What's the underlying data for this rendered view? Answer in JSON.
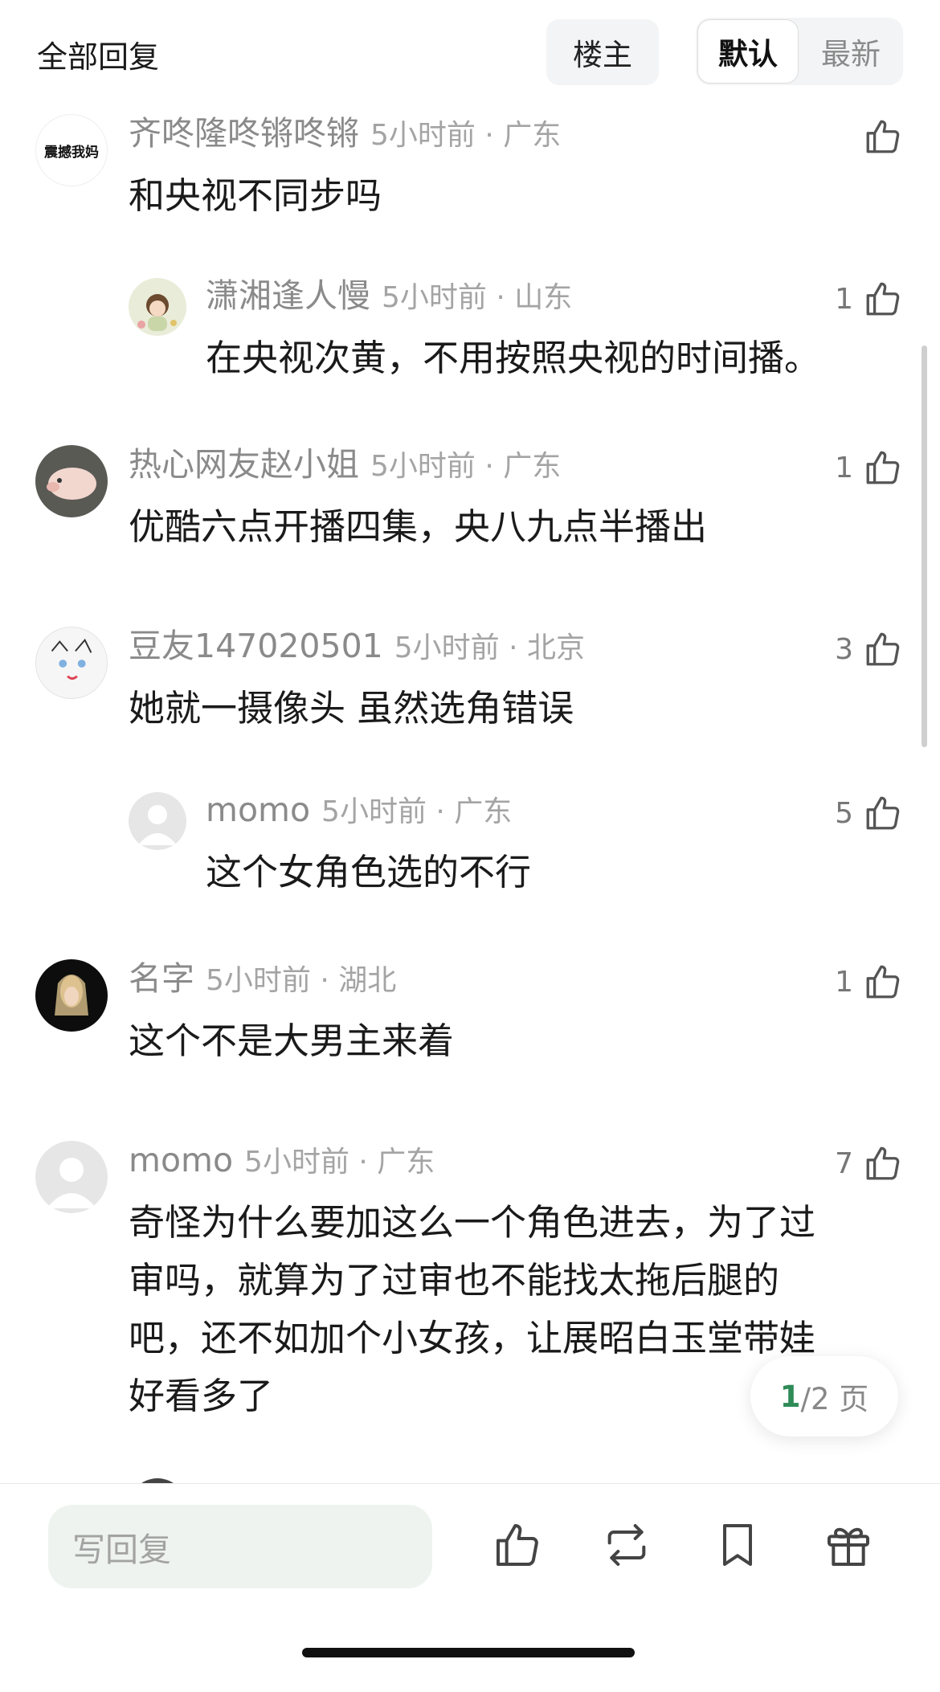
{
  "header": {
    "title": "全部回复",
    "owner_filter": "楼主",
    "sort_default": "默认",
    "sort_latest": "最新"
  },
  "comments": [
    {
      "username": "齐咚隆咚锵咚锵",
      "time": "5小时前 · 广东",
      "text": "和央视不同步吗",
      "likes": "",
      "avatar_text": "震撼我妈",
      "is_reply": false
    },
    {
      "username": "潇湘逢人慢",
      "time": "5小时前 · 山东",
      "text": "在央视次黄，不用按照央视的时间播。",
      "likes": "1",
      "avatar_text": "",
      "is_reply": true
    },
    {
      "username": "热心网友赵小姐",
      "time": "5小时前 · 广东",
      "text": "优酷六点开播四集，央八九点半播出",
      "likes": "1",
      "avatar_text": "",
      "is_reply": false
    },
    {
      "username": "豆友147020501",
      "time": "5小时前 · 北京",
      "text": "她就一摄像头 虽然选角错误",
      "likes": "3",
      "avatar_text": "",
      "is_reply": false
    },
    {
      "username": "momo",
      "time": "5小时前 · 广东",
      "text": "这个女角色选的不行",
      "likes": "5",
      "avatar_text": "",
      "is_reply": true
    },
    {
      "username": "名字",
      "time": "5小时前 · 湖北",
      "text": "这个不是大男主来着",
      "likes": "1",
      "avatar_text": "",
      "is_reply": false
    },
    {
      "username": "momo",
      "time": "5小时前 · 广东",
      "text_lines": [
        "奇怪为什么要加这么一个角色进去，为了过",
        "审吗，就算为了过审也不能找太拖后腿的",
        "吧，还不如加个小女孩，让展昭白玉堂带娃",
        "好看多了"
      ],
      "likes": "7",
      "avatar_text": "",
      "is_reply": false
    }
  ],
  "pager": {
    "current": "1",
    "total": "/2 页"
  },
  "bottom_bar": {
    "reply_placeholder": "写回复",
    "icons": [
      "thumbs-up-icon",
      "repost-icon",
      "bookmark-icon",
      "gift-icon"
    ]
  }
}
